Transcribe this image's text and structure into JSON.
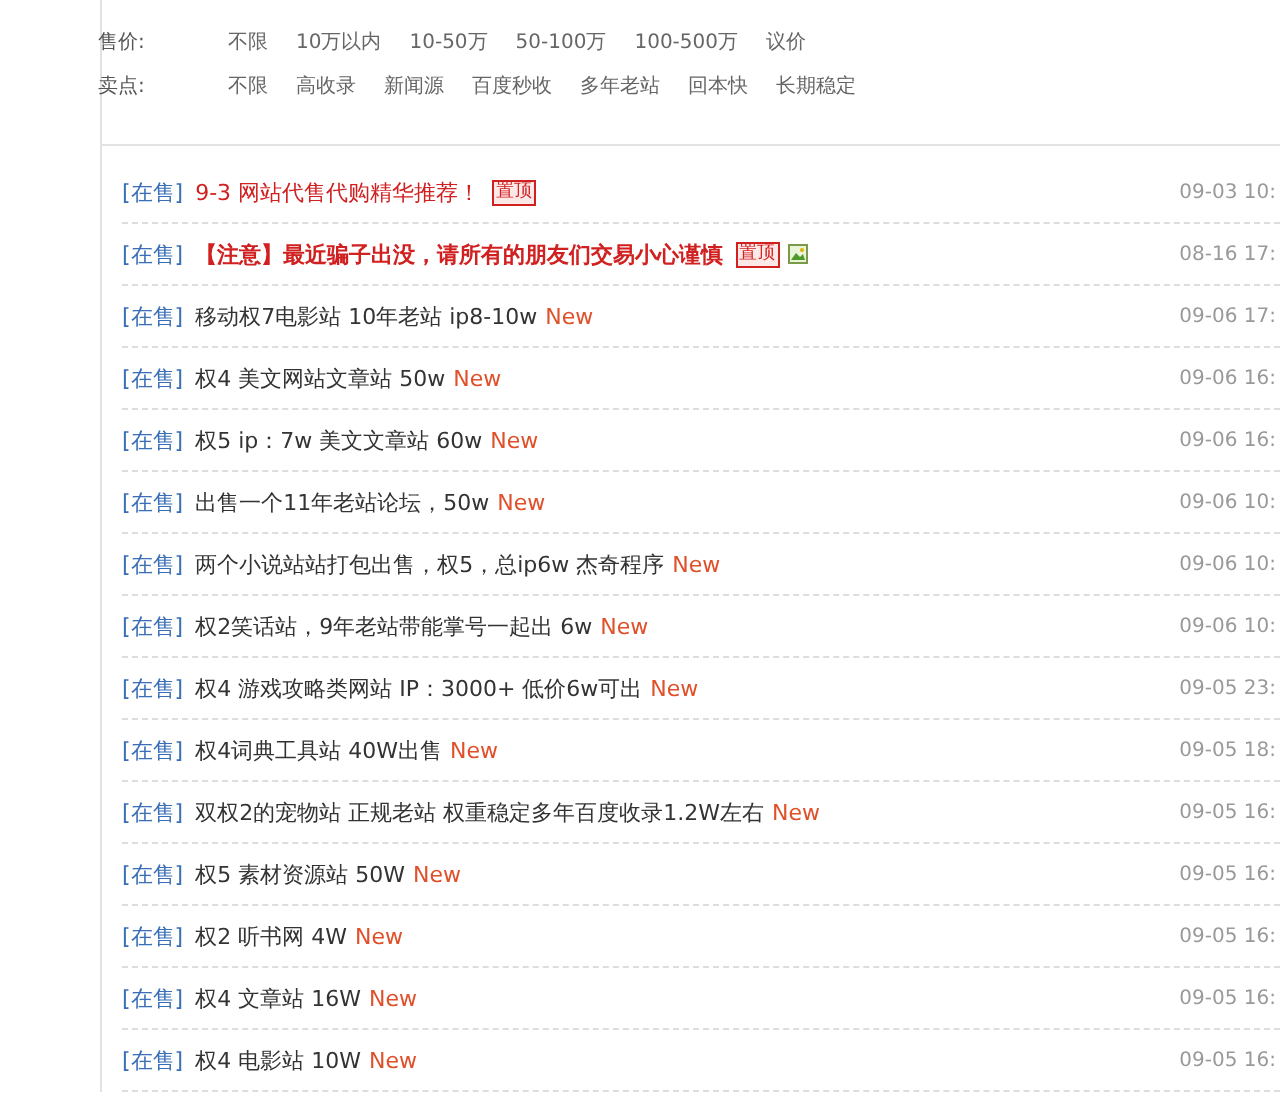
{
  "filters": [
    {
      "label": "售价:",
      "options": [
        "不限",
        "10万以内",
        "10-50万",
        "50-100万",
        "100-500万",
        "议价"
      ]
    },
    {
      "label": "卖点:",
      "options": [
        "不限",
        "高收录",
        "新闻源",
        "百度秒收",
        "多年老站",
        "回本快",
        "长期稳定"
      ]
    }
  ],
  "listings": [
    {
      "status": "[在售]",
      "title": "9-3 网站代售代购精华推荐！",
      "kind": "highlight",
      "pin": "置顶",
      "image_icon": false,
      "time": "09-03 10:"
    },
    {
      "status": "[在售]",
      "title": "【注意】最近骗子出没，请所有的朋友们交易小心谨慎",
      "kind": "warning",
      "pin": "置顶",
      "image_icon": true,
      "time": "08-16 17:"
    },
    {
      "status": "[在售]",
      "title": "移动权7电影站 10年老站 ip8-10w",
      "kind": "normal",
      "new": "New",
      "time": "09-06 17:"
    },
    {
      "status": "[在售]",
      "title": "权4 美文网站文章站 50w",
      "kind": "normal",
      "new": "New",
      "time": "09-06 16:"
    },
    {
      "status": "[在售]",
      "title": "权5 ip：7w 美文文章站 60w",
      "kind": "normal",
      "new": "New",
      "time": "09-06 16:"
    },
    {
      "status": "[在售]",
      "title": "出售一个11年老站论坛，50w",
      "kind": "normal",
      "new": "New",
      "time": "09-06 10:"
    },
    {
      "status": "[在售]",
      "title": "两个小说站站打包出售，权5，总ip6w 杰奇程序",
      "kind": "normal",
      "new": "New",
      "time": "09-06 10:"
    },
    {
      "status": "[在售]",
      "title": "权2笑话站，9年老站带能掌号一起出 6w",
      "kind": "normal",
      "new": "New",
      "time": "09-06 10:"
    },
    {
      "status": "[在售]",
      "title": "权4 游戏攻略类网站 IP：3000+ 低价6w可出",
      "kind": "normal",
      "new": "New",
      "time": "09-05 23:"
    },
    {
      "status": "[在售]",
      "title": "权4词典工具站 40W出售",
      "kind": "normal",
      "new": "New",
      "time": "09-05 18:"
    },
    {
      "status": "[在售]",
      "title": "双权2的宠物站 正规老站 权重稳定多年百度收录1.2W左右",
      "kind": "normal",
      "new": "New",
      "time": "09-05 16:"
    },
    {
      "status": "[在售]",
      "title": "权5 素材资源站 50W",
      "kind": "normal",
      "new": "New",
      "time": "09-05 16:"
    },
    {
      "status": "[在售]",
      "title": "权2 听书网 4W",
      "kind": "normal",
      "new": "New",
      "time": "09-05 16:"
    },
    {
      "status": "[在售]",
      "title": "权4 文章站 16W",
      "kind": "normal",
      "new": "New",
      "time": "09-05 16:"
    },
    {
      "status": "[在售]",
      "title": "权4 电影站 10W",
      "kind": "normal",
      "new": "New",
      "time": "09-05 16:"
    }
  ]
}
